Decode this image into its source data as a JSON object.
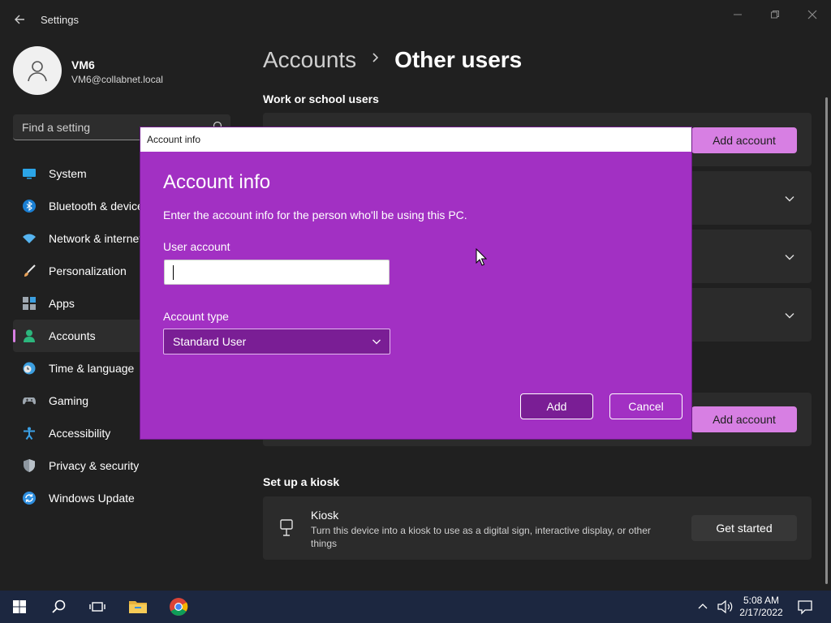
{
  "window": {
    "title": "Settings",
    "back_icon": "back-arrow-icon"
  },
  "profile": {
    "name": "VM6",
    "email": "VM6@collabnet.local"
  },
  "search": {
    "placeholder": "Find a setting"
  },
  "sidebar": {
    "items": [
      {
        "label": "System",
        "icon": "monitor-icon",
        "color": "#2ba5e8"
      },
      {
        "label": "Bluetooth & devices",
        "icon": "bluetooth-icon",
        "color": "#1a7fd4"
      },
      {
        "label": "Network & internet",
        "icon": "wifi-icon",
        "color": "#56b4f0"
      },
      {
        "label": "Personalization",
        "icon": "brush-icon",
        "color": "#e8a25a"
      },
      {
        "label": "Apps",
        "icon": "apps-icon",
        "color": "#9ea7b0"
      },
      {
        "label": "Accounts",
        "icon": "person-icon",
        "color": "#2cb67d",
        "selected": true
      },
      {
        "label": "Time & language",
        "icon": "clock-globe-icon",
        "color": "#3c9fe0"
      },
      {
        "label": "Gaming",
        "icon": "gamepad-icon",
        "color": "#9ea7b0"
      },
      {
        "label": "Accessibility",
        "icon": "accessibility-icon",
        "color": "#3aa0e6"
      },
      {
        "label": "Privacy & security",
        "icon": "shield-icon",
        "color": "#8e97a0"
      },
      {
        "label": "Windows Update",
        "icon": "update-icon",
        "color": "#2e8fe0"
      }
    ]
  },
  "main": {
    "breadcrumb_parent": "Accounts",
    "breadcrumb_current": "Other users",
    "work_heading": "Work or school users",
    "add_account_label": "Add account",
    "kiosk_heading": "Set up a kiosk",
    "kiosk_title": "Kiosk",
    "kiosk_desc": "Turn this device into a kiosk to use as a digital sign, interactive display, or other things",
    "get_started_label": "Get started"
  },
  "dialog": {
    "window_title": "Account info",
    "heading": "Account info",
    "description": "Enter the account info for the person who'll be using this PC.",
    "user_account_label": "User account",
    "user_account_value": "",
    "account_type_label": "Account type",
    "account_type_value": "Standard User",
    "add_label": "Add",
    "cancel_label": "Cancel"
  },
  "taskbar": {
    "time": "5:08 AM",
    "date": "2/17/2022"
  },
  "colors": {
    "accent": "#d77fe3",
    "dialog_bg": "#a230c3"
  }
}
